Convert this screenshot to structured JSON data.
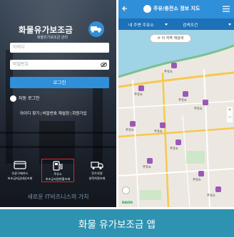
{
  "login_screen": {
    "brand_title": "화물유가보조금",
    "brand_subtitle": "화물유가보조금 관리",
    "id_placeholder": "아이디",
    "pw_placeholder": "비밀번호",
    "login_label": "로그인",
    "auto_login_label": "자동 로그인",
    "links": {
      "find": "아이디 찾기",
      "reset": "비밀번호 재설정",
      "signup": "회원가입"
    },
    "menu": [
      {
        "line1": "유류구매카드",
        "line2": "보조금지급대상조회"
      },
      {
        "line1": "주유소",
        "line2": "보조금지원현황조회"
      },
      {
        "line1": "전수차량",
        "line2": "실적차량조회"
      }
    ],
    "tagline": "새로운 IT비즈니스의 가치"
  },
  "map_screen": {
    "header_title": "주유/충전소 정보 지도",
    "filter_nearby": "내 주변 주유소",
    "filter_search": "검색조건",
    "research_button": "이 지역 재검색",
    "place_labels": [
      "주유소",
      "주유소",
      "주유소",
      "주유소",
      "주유소",
      "주유소",
      "주유소",
      "주유소",
      "주유소",
      "주유소"
    ],
    "map_brand": "NAVER",
    "colors": {
      "pin": "#9b59b6",
      "water": "#9fd3e6",
      "road": "#f6c84c",
      "header": "#2f8fd9"
    }
  },
  "caption": "화물 유가보조금 앱"
}
